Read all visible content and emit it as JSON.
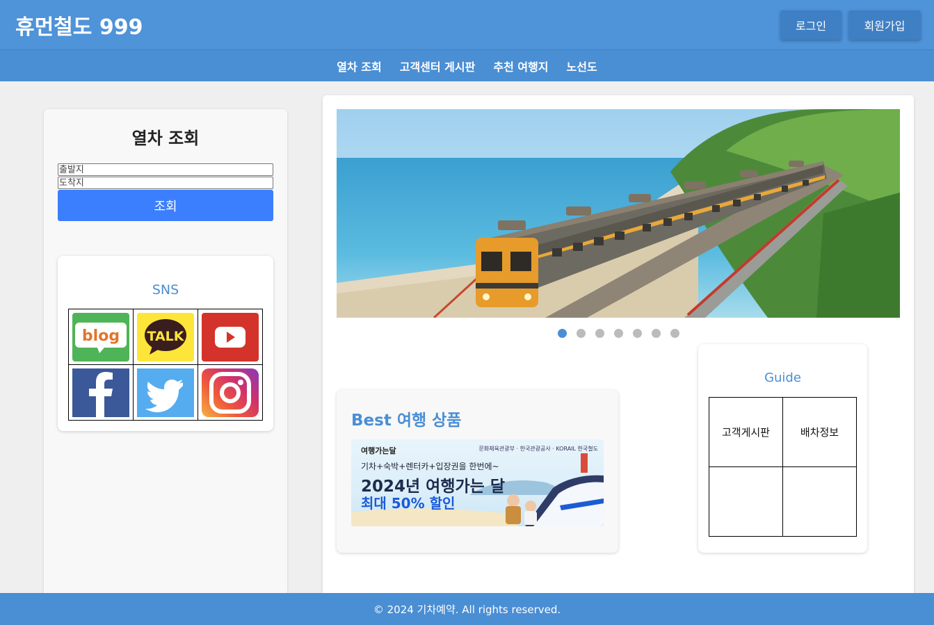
{
  "header": {
    "title": "휴먼철도 999",
    "login_label": "로그인",
    "signup_label": "회원가입"
  },
  "nav": {
    "items": [
      "열차 조회",
      "고객센터 게시판",
      "추천 여행지",
      "노선도"
    ]
  },
  "sidebar": {
    "title": "열차 조회",
    "departure_placeholder": "출발지",
    "arrival_placeholder": "도착지",
    "search_label": "조회",
    "sns": {
      "title": "SNS",
      "icons": [
        "blog-icon",
        "kakaotalk-icon",
        "youtube-icon",
        "facebook-icon",
        "twitter-icon",
        "instagram-icon"
      ],
      "blog_text": "blog",
      "talk_text": "TALK"
    }
  },
  "main": {
    "banner": {
      "slides_total": 7,
      "active_slide": 1
    },
    "best": {
      "title": "Best 여행 상품",
      "ad": {
        "logo": "여행가는달",
        "partners": "문화체육관광부 · 한국관광공사 · KORAIL 한국철도",
        "line1": "기차+숙박+렌터카+입장권을 한번에~",
        "line2": "2024년 여행가는 달",
        "line3": "최대 50% 할인"
      }
    },
    "guide": {
      "title": "Guide",
      "cells": [
        "고객게시판",
        "배차정보",
        "",
        ""
      ]
    }
  },
  "footer": {
    "text": "© 2024 기차예약. All rights reserved."
  },
  "colors": {
    "primary": "#4a8ed4",
    "button_blue": "#3b7fff",
    "header_button": "#3f7fc3"
  }
}
